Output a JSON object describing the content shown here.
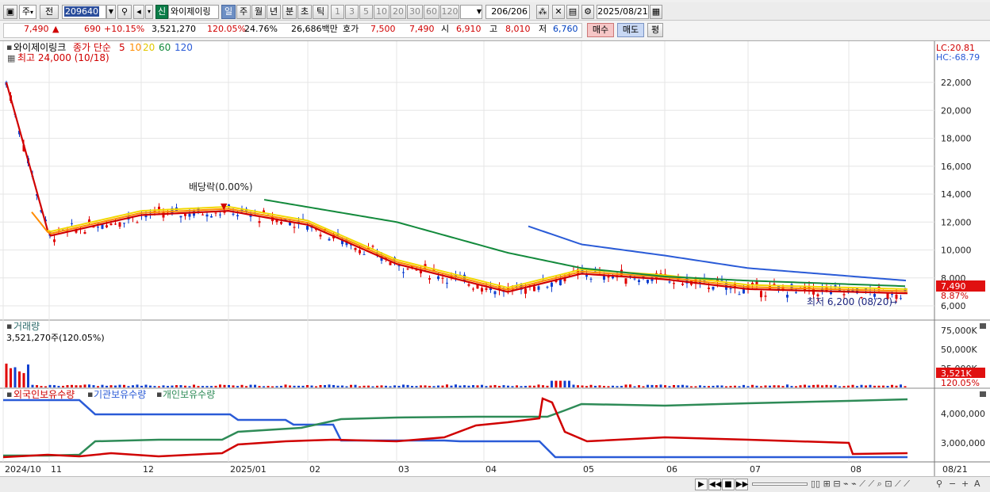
{
  "toolbar": {
    "market": "주",
    "prev": "전",
    "code": "209640",
    "credit": "신",
    "name": "와이제이링",
    "periods": [
      "일",
      "주",
      "월",
      "년",
      "분",
      "초",
      "틱"
    ],
    "intervals": [
      "1",
      "3",
      "5",
      "10",
      "20",
      "30",
      "60",
      "120"
    ],
    "count": "206",
    "count_total": "/206",
    "date": "2025/08/21"
  },
  "quote": {
    "price": "7,490",
    "arrow": "▲",
    "change": "690",
    "change_pct": "+10.15%",
    "volume": "3,521,270",
    "volume_pct": "120.05%",
    "turnover": "24.76%",
    "amount": "26,686백만",
    "ask_label": "호가",
    "ask": "7,500",
    "bid": "7,490",
    "open_label": "시",
    "open": "6,910",
    "high_label": "고",
    "high": "8,010",
    "low_label": "저",
    "low": "6,760",
    "buy": "매수",
    "sell": "매도",
    "eval": "평"
  },
  "price_panel": {
    "name": "와이제이링크",
    "ma_label": "종가 단순",
    "ma": [
      "5",
      "10",
      "20",
      "60",
      "120"
    ],
    "ma_colors": [
      "#d00000",
      "#ff8c00",
      "#f2d800",
      "#138a3c",
      "#2a5bd7"
    ],
    "high_note": "최고 24,000 (10/18)",
    "low_note": "최저 6,200 (08/20)",
    "dividend": "배당락(0.00%)",
    "lc": "LC:20.81",
    "hc": "HC:-68.79",
    "y_ticks": [
      "22,000",
      "20,000",
      "18,000",
      "16,000",
      "14,000",
      "12,000",
      "10,000",
      "8,000",
      "6,000"
    ],
    "last_price_tag": "7,490",
    "pct_tag": "8.87%"
  },
  "volume_panel": {
    "title": "거래량",
    "value": "3,521,270주(120.05%)",
    "y_ticks": [
      "75,000K",
      "50,000K",
      "25,000K"
    ],
    "last_tag": "3,521K",
    "pct_tag": "120.05%"
  },
  "holdings_panel": {
    "series": [
      "외국인보유수량",
      "기관보유수량",
      "개인보유수량"
    ],
    "series_colors": [
      "#d00000",
      "#2a5bd7",
      "#2e8b57"
    ],
    "y_ticks": [
      "4,000,000",
      "3,000,000"
    ]
  },
  "x_axis": [
    "2024/10",
    "11",
    "12",
    "2025/01",
    "02",
    "03",
    "04",
    "05",
    "06",
    "07",
    "08",
    "08/21"
  ],
  "chart_data": {
    "type": "line",
    "categories": [
      "2024/10",
      "11",
      "12",
      "2025/01",
      "02",
      "03",
      "04",
      "05",
      "06",
      "07",
      "08"
    ],
    "series": [
      {
        "name": "5",
        "values": [
          22000,
          11000,
          12500,
          12800,
          11800,
          9000,
          7000,
          8300,
          7900,
          7200,
          6900
        ]
      },
      {
        "name": "120",
        "values": [
          null,
          null,
          null,
          null,
          null,
          null,
          11700,
          10400,
          9600,
          8700,
          7800
        ]
      }
    ],
    "ylim": [
      6000,
      22000
    ]
  }
}
